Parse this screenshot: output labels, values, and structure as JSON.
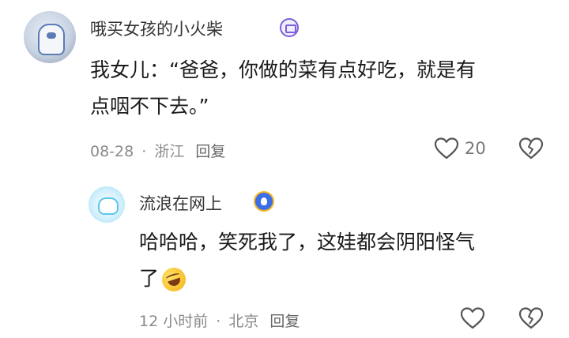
{
  "comments": [
    {
      "username": "哦买女孩的小火柴",
      "badge_icon": "vip-badge-icon",
      "content_lines": [
        "我女儿：“爸爸，你做的菜有点好吃，就是有",
        "点咽不下去。”"
      ],
      "date": "08-28",
      "separator": "·",
      "location": "浙江",
      "reply_label": "回复",
      "like_count": "20"
    }
  ],
  "reply": {
    "username": "流浪在网上",
    "badge_icon": "fish-badge-icon",
    "content_lines": [
      "哈哈哈，笑死我了，这娃都会阴阳怪气",
      "了"
    ],
    "emoji": "rolling-laughing-emoji",
    "time": "12 小时前",
    "separator": "·",
    "location": "北京",
    "reply_label": "回复"
  },
  "colors": {
    "text": "#1a1a1a",
    "meta": "#8a8a8a",
    "icon": "#555555"
  }
}
